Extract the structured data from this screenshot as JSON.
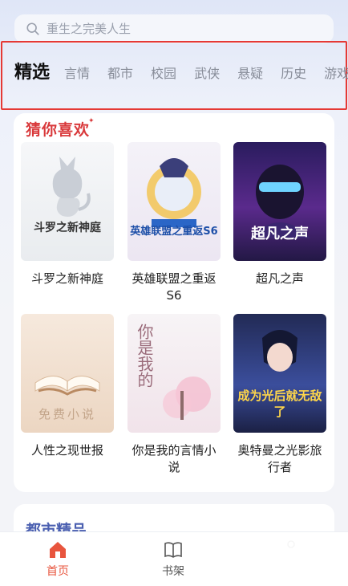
{
  "search": {
    "placeholder": "重生之完美人生"
  },
  "tabs": [
    "精选",
    "言情",
    "都市",
    "校园",
    "武侠",
    "悬疑",
    "历史",
    "游戏"
  ],
  "section_title": "猜你喜欢",
  "books": [
    {
      "title": "斗罗之新神庭",
      "cover_text": "斗罗之新神庭"
    },
    {
      "title": "英雄联盟之重返S6",
      "cover_text": "英雄联盟之重返S6"
    },
    {
      "title": "超凡之声",
      "cover_text": "超凡之声"
    },
    {
      "title": "人性之现世报",
      "cover_text": "免费小说"
    },
    {
      "title": "你是我的言情小说",
      "cover_text": "你是我的"
    },
    {
      "title": "奥特曼之光影旅行者",
      "cover_text": "成为光后就无敌了"
    }
  ],
  "section2_title": "都市精品",
  "tabbar": {
    "home": "首页",
    "shelf": "书架"
  },
  "colors": {
    "accent": "#d9393b",
    "home_active": "#e8553e"
  }
}
